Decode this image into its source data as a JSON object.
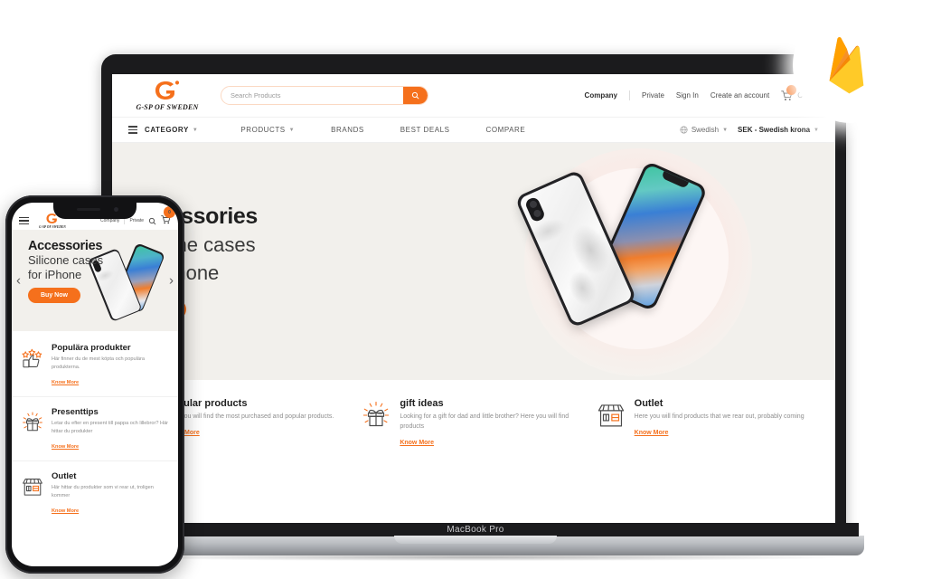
{
  "brand": {
    "name": "G-SP OF SWEDEN",
    "mark_color": "#f5701c"
  },
  "colors": {
    "accent": "#f5701c",
    "hero_background": "#f2f0ec",
    "text_dark": "#1f1f1f",
    "text_muted": "#8e8e8e"
  },
  "device": {
    "laptop_label": "MacBook Pro"
  },
  "search": {
    "placeholder": "Search Products",
    "value": "",
    "icon": "search-icon"
  },
  "header_links": {
    "company": "Company",
    "private": "Private",
    "sign_in": "Sign In",
    "create_account": "Create an account",
    "cart_label": "Cart",
    "cart_count": "0",
    "cart_icon": "cart-icon"
  },
  "nav": {
    "items": [
      {
        "label": "CATEGORY",
        "caret": true,
        "icon": "hamburger-icon"
      },
      {
        "label": "PRODUCTS",
        "caret": true
      },
      {
        "label": "BRANDS",
        "caret": false
      },
      {
        "label": "BEST DEALS",
        "caret": false
      },
      {
        "label": "COMPARE",
        "caret": false
      }
    ],
    "language": "Swedish",
    "language_icon": "globe-icon",
    "currency": "SEK - Swedish krona"
  },
  "hero": {
    "title": "Accessories",
    "line2": "Silicone cases",
    "line3": "for iPhone",
    "cta": "Buy Now",
    "prev_arrow": "‹",
    "next_arrow": "›"
  },
  "features": [
    {
      "icon": "thumbs-up-stars-icon",
      "title": "popular products",
      "desc": "Here you will find the most purchased and popular products.",
      "link": "Know More"
    },
    {
      "icon": "gift-box-icon",
      "title": "gift ideas",
      "desc": "Looking for a gift for dad and little brother? Here you will find products",
      "link": "Know More"
    },
    {
      "icon": "storefront-icon",
      "title": "Outlet",
      "desc": "Here you will find products that we rear out, probably coming",
      "link": "Know More"
    }
  ],
  "mobile": {
    "header": {
      "company": "Company",
      "private": "Private",
      "search_icon": "search-icon",
      "cart_icon": "cart-icon",
      "cart_count": "0",
      "menu_icon": "hamburger-icon"
    },
    "hero": {
      "title": "Accessories",
      "line2": "Silicone cases",
      "line3": "for iPhone",
      "cta": "Buy Now"
    },
    "features": [
      {
        "icon": "thumbs-up-stars-icon",
        "title": "Populära produkter",
        "desc": "Här finner du de mest köpta och populära produkterna.",
        "link": "Know More"
      },
      {
        "icon": "gift-box-icon",
        "title": "Presenttips",
        "desc": "Letar du efter en present till pappa och lillebror? Här hittar du produkter",
        "link": "Know More"
      },
      {
        "icon": "storefront-icon",
        "title": "Outlet",
        "desc": "Här hittar du produkter som vi rear ut, troligen kommer",
        "link": "Know More"
      }
    ]
  },
  "badge": {
    "icon": "firebase-logo"
  }
}
